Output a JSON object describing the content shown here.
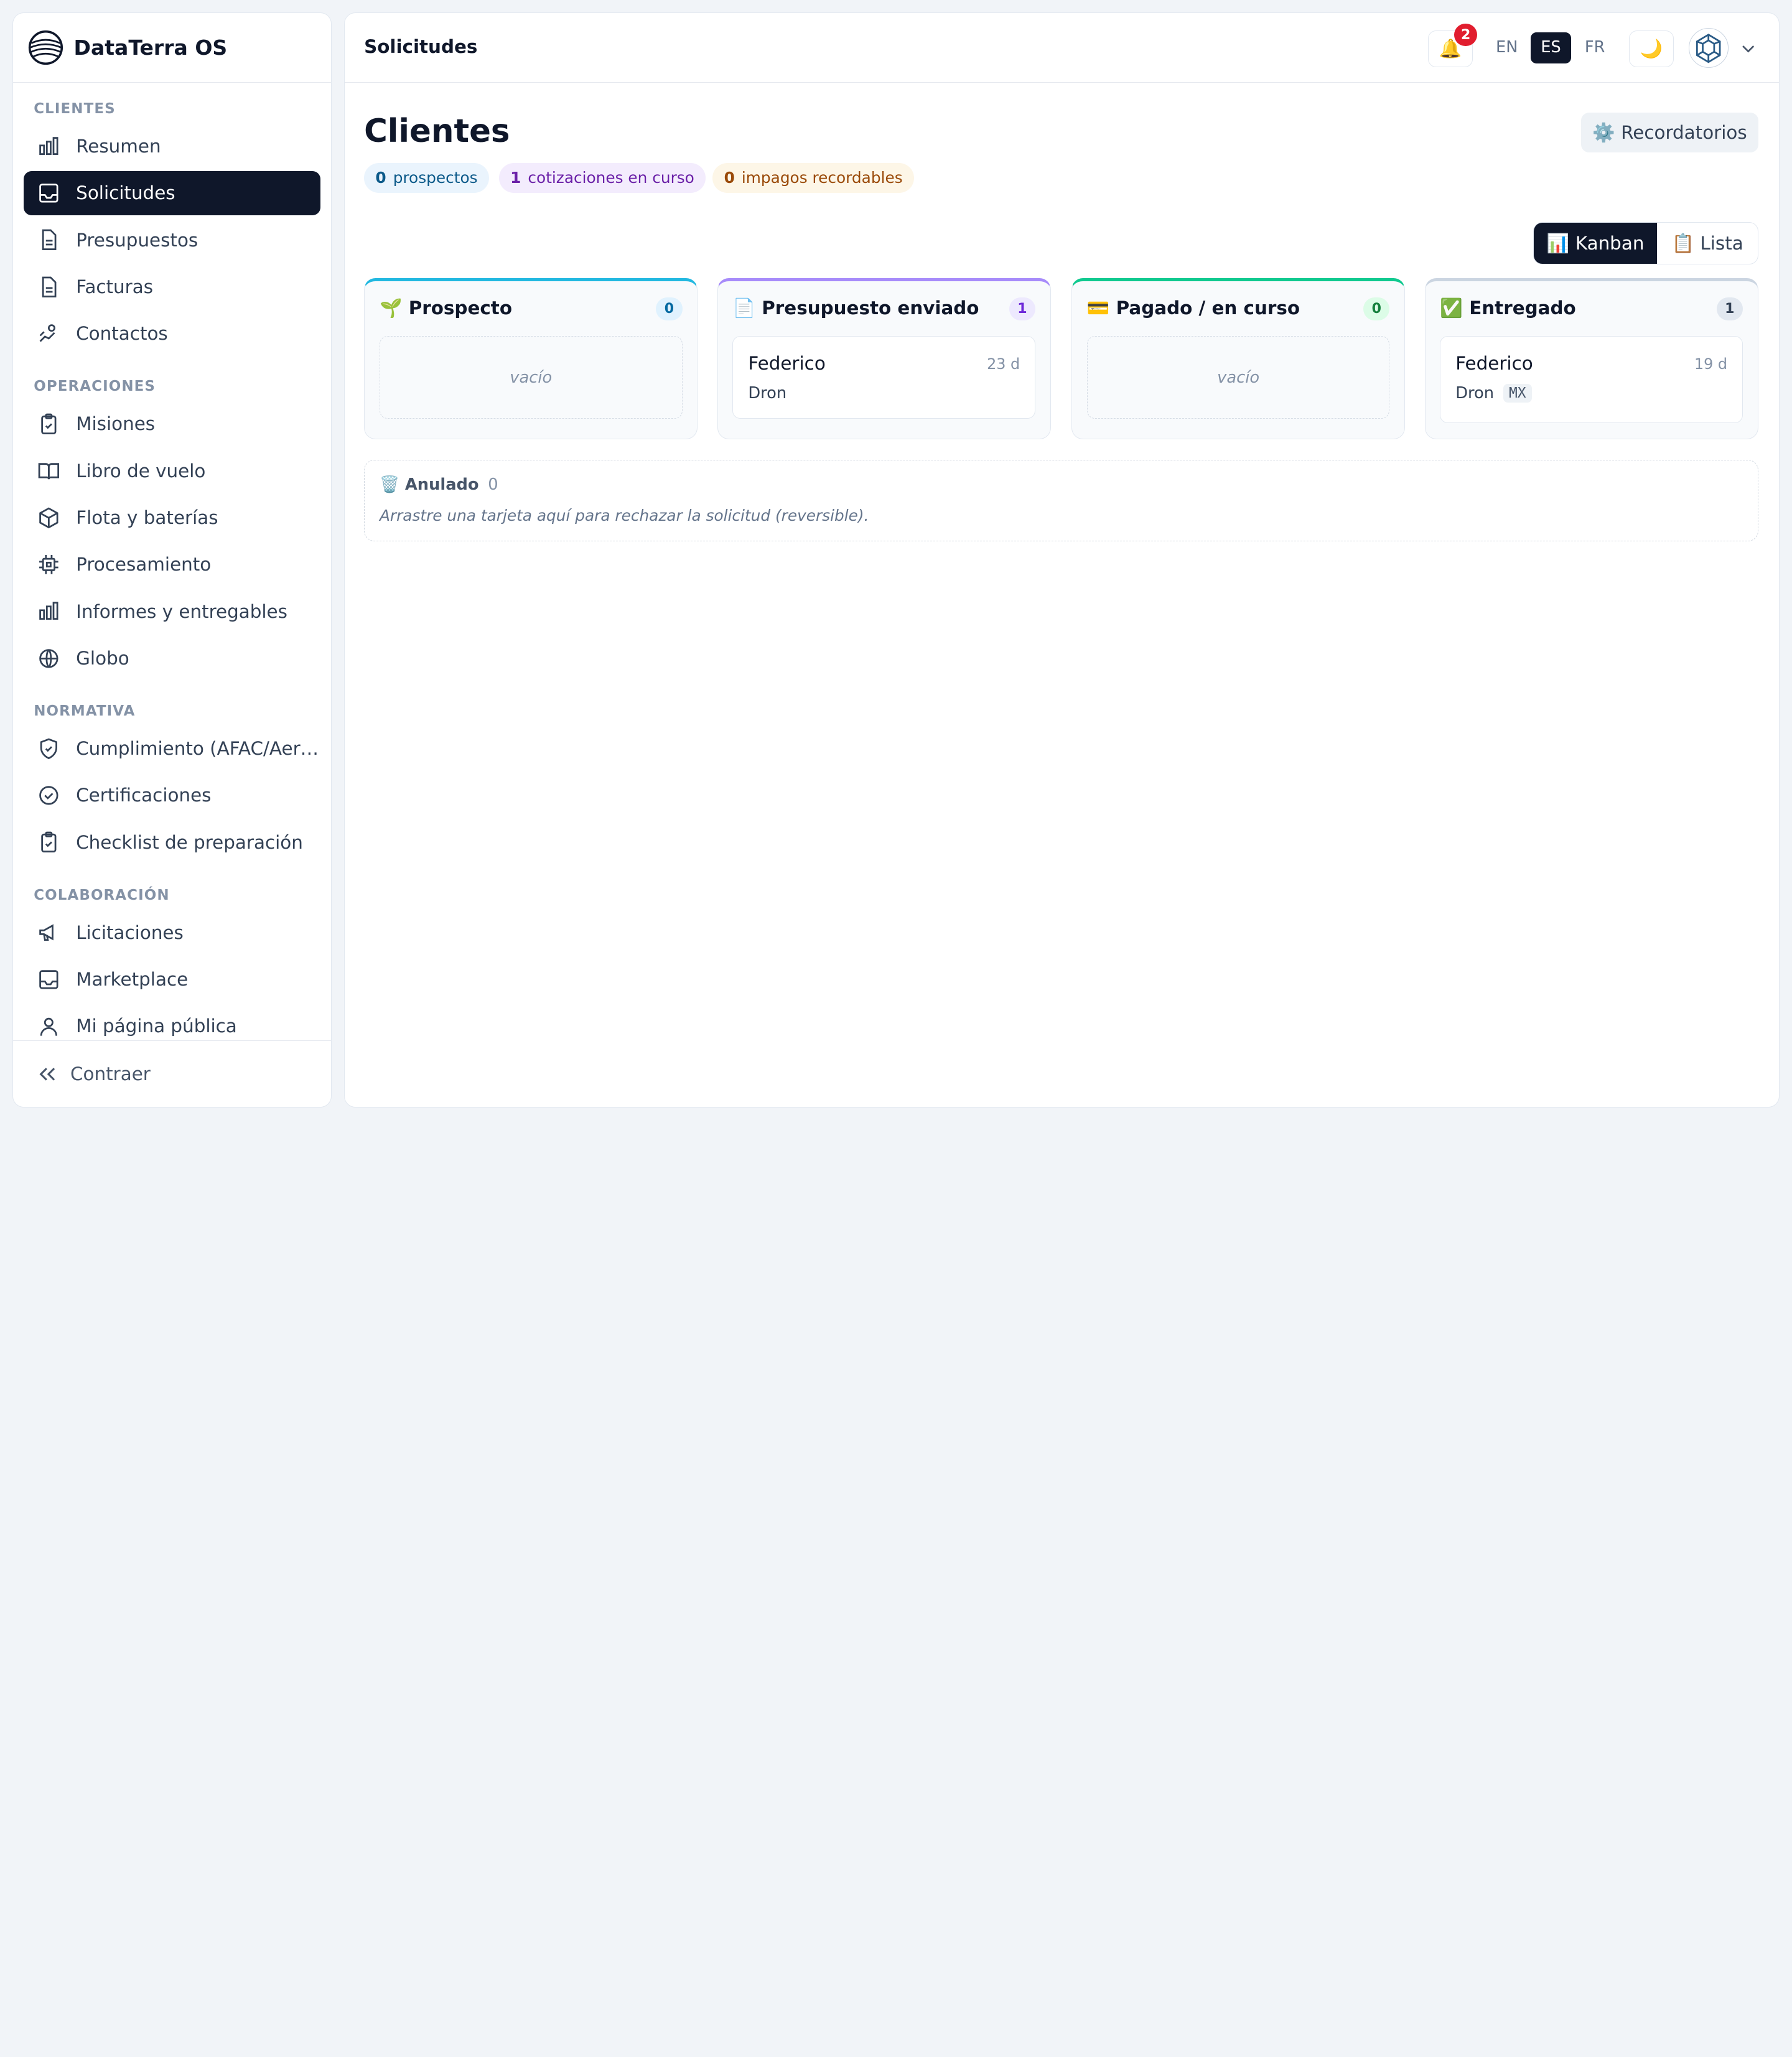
{
  "brand": {
    "name": "DataTerra OS"
  },
  "sidebar": {
    "sections": [
      {
        "label": "CLIENTES",
        "items": [
          {
            "label": "Resumen",
            "icon": "bar-chart-icon"
          },
          {
            "label": "Solicitudes",
            "icon": "inbox-icon",
            "active": true
          },
          {
            "label": "Presupuestos",
            "icon": "document-icon"
          },
          {
            "label": "Facturas",
            "icon": "document-icon"
          },
          {
            "label": "Contactos",
            "icon": "handshake-icon"
          }
        ]
      },
      {
        "label": "OPERACIONES",
        "items": [
          {
            "label": "Misiones",
            "icon": "clipboard-check-icon"
          },
          {
            "label": "Libro de vuelo",
            "icon": "book-open-icon"
          },
          {
            "label": "Flota y baterías",
            "icon": "package-icon"
          },
          {
            "label": "Procesamiento",
            "icon": "cpu-icon"
          },
          {
            "label": "Informes y entregables",
            "icon": "bar-chart-icon"
          },
          {
            "label": "Globo",
            "icon": "globe-icon"
          }
        ]
      },
      {
        "label": "NORMATIVA",
        "items": [
          {
            "label": "Cumplimiento (AFAC/Aer…",
            "icon": "shield-check-icon"
          },
          {
            "label": "Certificaciones",
            "icon": "check-circle-icon"
          },
          {
            "label": "Checklist de preparación",
            "icon": "clipboard-check-icon"
          }
        ]
      },
      {
        "label": "COLABORACIÓN",
        "items": [
          {
            "label": "Licitaciones",
            "icon": "megaphone-icon"
          },
          {
            "label": "Marketplace",
            "icon": "inbox-icon"
          },
          {
            "label": "Mi página pública",
            "icon": "user-icon"
          }
        ]
      }
    ],
    "collapse_label": "Contraer"
  },
  "topbar": {
    "breadcrumb": "Solicitudes",
    "notifications_count": "2",
    "languages": [
      "EN",
      "ES",
      "FR"
    ],
    "selected_language": "ES",
    "theme_icon": "🌙",
    "bell_icon": "🔔"
  },
  "page": {
    "title": "Clientes",
    "reminders_label": "⚙️ Recordatorios",
    "stats": [
      {
        "count": "0",
        "label": "prospectos",
        "color": "blue"
      },
      {
        "count": "1",
        "label": "cotizaciones en curso",
        "color": "purple"
      },
      {
        "count": "0",
        "label": "impagos recordables",
        "color": "orange"
      }
    ],
    "view_toggle": {
      "kanban": "📊 Kanban",
      "list": "📋 Lista",
      "selected": "kanban"
    }
  },
  "kanban": {
    "columns": [
      {
        "title": "🌱 Prospecto",
        "count": "0",
        "accent": "#22b8e0",
        "badge_bg": "#e0f2fe",
        "badge_fg": "#0369a1",
        "empty_label": "vacío",
        "cards": []
      },
      {
        "title": "📄 Presupuesto enviado",
        "count": "1",
        "accent": "#a78bfa",
        "badge_bg": "#ede9fe",
        "badge_fg": "#6d28d9",
        "cards": [
          {
            "name": "Federico",
            "age": "23 d",
            "type": "Dron"
          }
        ]
      },
      {
        "title": "💳 Pagado / en curso",
        "count": "0",
        "accent": "#10c98f",
        "badge_bg": "#dcfce7",
        "badge_fg": "#15803d",
        "empty_label": "vacío",
        "cards": []
      },
      {
        "title": "✅ Entregado",
        "count": "1",
        "accent": "#cbd5e1",
        "badge_bg": "#e2e8f0",
        "badge_fg": "#334155",
        "cards": [
          {
            "name": "Federico",
            "age": "19 d",
            "type": "Dron",
            "tag": "MX"
          }
        ]
      }
    ],
    "void_zone": {
      "title": "🗑️ Anulado",
      "count": "0",
      "hint": "Arrastre una tarjeta aquí para rechazar la solicitud (reversible)."
    }
  }
}
